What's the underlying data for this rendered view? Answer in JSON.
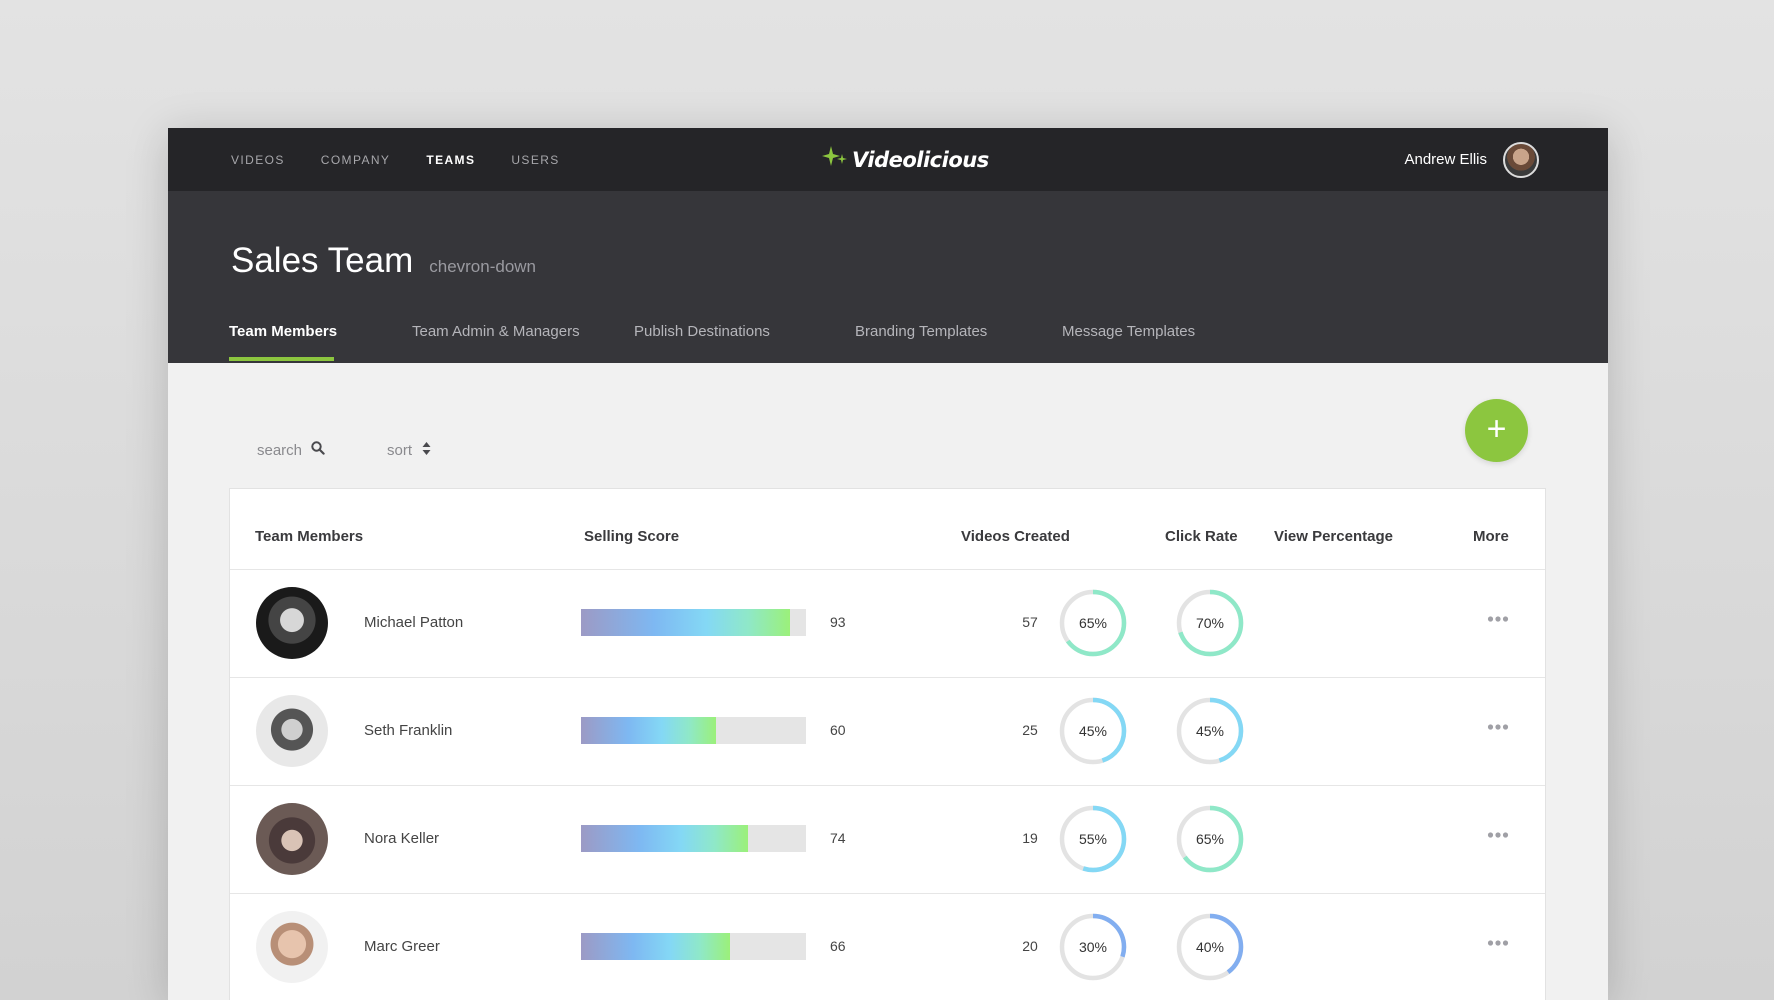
{
  "topbar": {
    "nav": [
      "VIDEOS",
      "COMPANY",
      "TEAMS",
      "USERS"
    ],
    "active_nav": 2,
    "logo": "Videolicious",
    "user_name": "Andrew Ellis"
  },
  "header": {
    "title": "Sales Team",
    "title_dropdown": "chevron-down",
    "tabs": [
      "Team Members",
      "Team Admin & Managers",
      "Publish Destinations",
      "Branding Templates",
      "Message Templates"
    ],
    "active_tab": 0
  },
  "toolbar": {
    "search_label": "search",
    "sort_label": "sort",
    "add_button": "+"
  },
  "table": {
    "headers": {
      "members": "Team Members",
      "selling": "Selling Score",
      "videos": "Videos Created",
      "click": "Click Rate",
      "view": "View Percentage",
      "more": "More"
    },
    "rows": [
      {
        "name": "Michael Patton",
        "selling_score": 93,
        "score_label": "93",
        "videos": "57",
        "click_rate": 65,
        "click_label": "65%",
        "view_pct": 70,
        "view_label": "70%"
      },
      {
        "name": "Seth Franklin",
        "selling_score": 60,
        "score_label": "60",
        "videos": "25",
        "click_rate": 45,
        "click_label": "45%",
        "view_pct": 45,
        "view_label": "45%"
      },
      {
        "name": "Nora Keller",
        "selling_score": 74,
        "score_label": "74",
        "videos": "19",
        "click_rate": 55,
        "click_label": "55%",
        "view_pct": 65,
        "view_label": "65%"
      },
      {
        "name": "Marc Greer",
        "selling_score": 66,
        "score_label": "66",
        "videos": "20",
        "click_rate": 30,
        "click_label": "30%",
        "view_pct": 40,
        "view_label": "40%"
      }
    ]
  },
  "colors": {
    "accent": "#8cc63f",
    "topbar": "#252528",
    "header": "#36363a",
    "ring_track": "#e3e3e3",
    "ring_low": "#82aef0",
    "ring_mid": "#84d8f5",
    "ring_high": "#8fe8c8"
  },
  "icons": {
    "search": "search-icon",
    "sort": "sort-icon",
    "more": "ellipsis-icon",
    "logo": "sparkle-icon"
  }
}
